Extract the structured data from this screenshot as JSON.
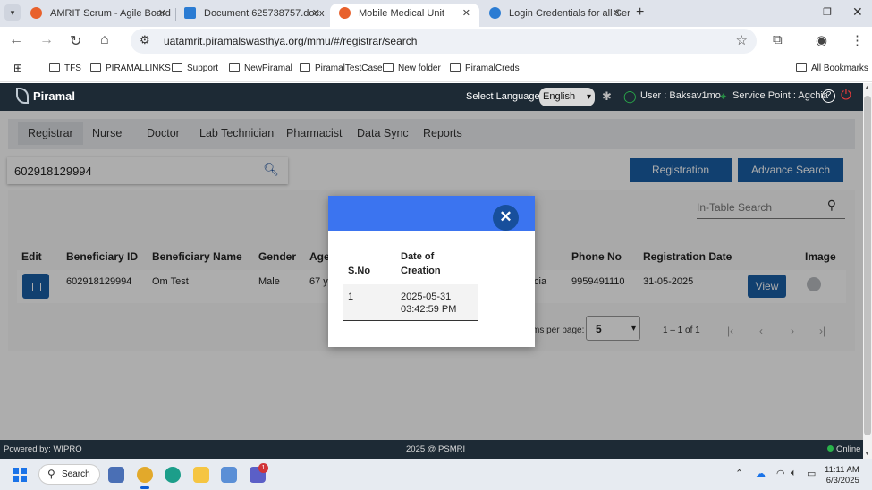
{
  "browser": {
    "tabs": [
      {
        "title": "AMRIT Scrum - Agile Board",
        "favicon_color": "#e8612c",
        "active": false
      },
      {
        "title": "Document 625738757.docx",
        "favicon_color": "#2b7cd3",
        "active": false
      },
      {
        "title": "Mobile Medical Unit",
        "favicon_color": "#e8612c",
        "active": true
      },
      {
        "title": "Login Credentials for all Ser",
        "favicon_color": "#2b7cd3",
        "active": false
      }
    ],
    "url": "uatamrit.piramalswasthya.org/mmu/#/registrar/search",
    "bookmarks": [
      "TFS",
      "PIRAMALLINKS",
      "Support",
      "NewPiramal",
      "PiramalTestCase",
      "New folder",
      "PiramalCreds"
    ],
    "all_bookmarks": "All Bookmarks"
  },
  "header": {
    "brand": "Piramal",
    "language_label": "Select Language:",
    "language_value": "English",
    "user_label": "User : Baksav1mo",
    "service_point": "Service Point : Agchia",
    "help_glyph": "?",
    "power_glyph": "⏻"
  },
  "nav": {
    "tabs": [
      "Registrar",
      "Nurse",
      "Doctor",
      "Lab Technician",
      "Pharmacist",
      "Data Sync",
      "Reports"
    ],
    "active": "Registrar"
  },
  "search": {
    "value": "602918129994"
  },
  "actions": {
    "registration": "Registration",
    "advance_search": "Advance Search"
  },
  "in_table_search": {
    "placeholder": "In-Table Search"
  },
  "table": {
    "headers": [
      "Edit",
      "Beneficiary ID",
      "Beneficiary Name",
      "Gender",
      "Age",
      "Phone No",
      "Registration Date",
      "Image"
    ],
    "rows": [
      {
        "beneficiary_id": "602918129994",
        "name": "Om Test",
        "gender": "Male",
        "age_partial": "67 y",
        "village_partial": "cia",
        "phone": "9959491110",
        "registration_date": "31-05-2025",
        "view_label": "View"
      }
    ]
  },
  "pagination": {
    "items_per_page_label": "ms per page:",
    "page_size": "5",
    "range": "1 – 1 of 1"
  },
  "modal": {
    "close_glyph": "✕",
    "headers": [
      "S.No",
      "Date of",
      "Creation"
    ],
    "rows": [
      {
        "sno": "1",
        "date": "2025-05-31",
        "time": "03:42:59 PM"
      }
    ]
  },
  "footer": {
    "powered_by": "Powered by: WIPRO",
    "copyright": "2025 @ PSMRI",
    "status": "Online"
  },
  "taskbar": {
    "search_label": "Search",
    "teams_badge": "1",
    "time": "11:11 AM",
    "date": "6/3/2025"
  }
}
